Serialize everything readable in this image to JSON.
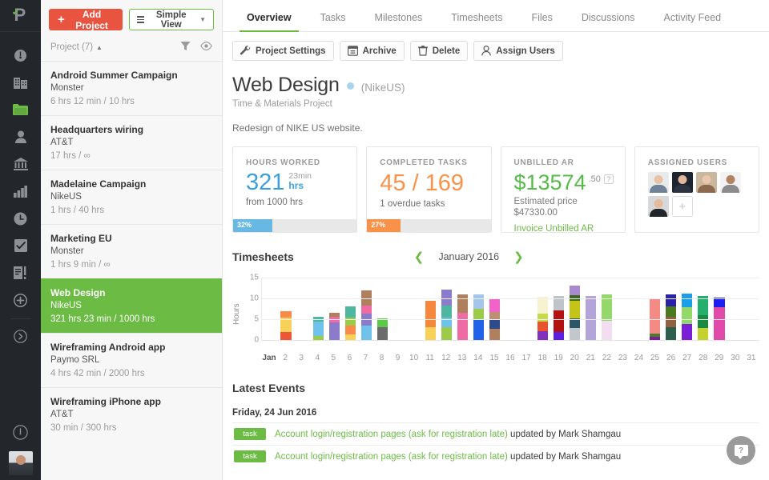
{
  "rail": {
    "logo_name": "paymo-logo",
    "items": [
      {
        "name": "dashboard-icon"
      },
      {
        "name": "clients-icon"
      },
      {
        "name": "projects-icon"
      },
      {
        "name": "users-icon"
      },
      {
        "name": "bank-icon"
      },
      {
        "name": "reports-icon"
      },
      {
        "name": "timesheets-icon"
      },
      {
        "name": "tasks-icon"
      },
      {
        "name": "invoices-icon"
      },
      {
        "name": "add-icon"
      },
      {
        "name": "expand-icon"
      }
    ],
    "timer_icon": "timer-icon",
    "avatar_name": "user-avatar"
  },
  "sidebar": {
    "add_project_label": "Add Project",
    "view_label": "Simple View",
    "list_title": "Project (7)",
    "filter_icon": "filter-icon",
    "eye_icon": "eye-icon",
    "projects": [
      {
        "name": "Android Summer Campaign",
        "client": "Monster",
        "hours": "6 hrs 12 min / 10 hrs",
        "selected": false
      },
      {
        "name": "Headquarters wiring",
        "client": "AT&T",
        "hours": "17 hrs / ∞",
        "selected": false
      },
      {
        "name": "Madelaine Campaign",
        "client": "NikeUS",
        "hours": "1 hrs / 40 hrs",
        "selected": false
      },
      {
        "name": "Marketing EU",
        "client": "Monster",
        "hours": "1 hrs 9 min / ∞",
        "selected": false
      },
      {
        "name": "Web Design",
        "client": "NikeUS",
        "hours": "321 hrs 23 min / 1000 hrs",
        "selected": true
      },
      {
        "name": "Wireframing Android app",
        "client": "Paymo SRL",
        "hours": "4 hrs 42 min / 2000 hrs",
        "selected": false
      },
      {
        "name": "Wireframing iPhone app",
        "client": "AT&T",
        "hours": "30 min / 300 hrs",
        "selected": false
      }
    ]
  },
  "tabs": [
    {
      "label": "Overview",
      "active": true
    },
    {
      "label": "Tasks",
      "active": false
    },
    {
      "label": "Milestones",
      "active": false
    },
    {
      "label": "Timesheets",
      "active": false
    },
    {
      "label": "Files",
      "active": false
    },
    {
      "label": "Discussions",
      "active": false
    },
    {
      "label": "Activity Feed",
      "active": false
    }
  ],
  "toolbar": [
    {
      "label": "Project Settings",
      "icon": "wrench-icon"
    },
    {
      "label": "Archive",
      "icon": "archive-icon"
    },
    {
      "label": "Delete",
      "icon": "trash-icon"
    },
    {
      "label": "Assign Users",
      "icon": "person-icon"
    }
  ],
  "project": {
    "title": "Web Design",
    "status_dot_color": "#a8d4ea",
    "client": "(NikeUS)",
    "type": "Time & Materials Project",
    "description": "Redesign of NIKE US website."
  },
  "cards": {
    "hours": {
      "label": "HOURS WORKED",
      "value": "321",
      "minutes": "23min",
      "unit": "hrs",
      "sub": "from 1000 hrs",
      "progress_pct": "32%",
      "progress_value": 32,
      "color": "#67b8e3"
    },
    "tasks": {
      "label": "COMPLETED TASKS",
      "value": "45 / 169",
      "sub": "1 overdue tasks",
      "progress_pct": "27%",
      "progress_value": 27,
      "color": "#f79248"
    },
    "unbilled": {
      "label": "UNBILLED AR",
      "value": "$13574",
      "cents": ".50",
      "help": "?",
      "sub_line1": "Estimated price",
      "sub_line2": "$47330.00",
      "link": "Invoice Unbilled AR"
    },
    "users": {
      "label": "ASSIGNED USERS",
      "add_label": "+",
      "avatars": [
        {
          "name": "avatar-1",
          "bg": "#e9eaec",
          "skin": "#e8c2a4",
          "shirt": "#6f8398"
        },
        {
          "name": "avatar-2",
          "bg": "#1d2530",
          "skin": "#e2b79b",
          "shirt": "#2b3440"
        },
        {
          "name": "avatar-3",
          "bg": "#cbb79e",
          "skin": "#e8c7ab",
          "shirt": "#8d6a4e"
        },
        {
          "name": "avatar-4",
          "bg": "#f2f2f2",
          "skin": "#b0825f",
          "shirt": "#8c8c8c"
        },
        {
          "name": "avatar-5",
          "bg": "#d6d8da",
          "skin": "#e5bb99",
          "shirt": "#23272c"
        }
      ]
    }
  },
  "timesheets": {
    "title": "Timesheets",
    "month": "January 2016",
    "prev_icon": "chevron-left-icon",
    "next_icon": "chevron-right-icon"
  },
  "chart_data": {
    "type": "bar",
    "stacked": true,
    "title": "Timesheets",
    "xlabel": "",
    "ylabel": "Hours",
    "ylim": [
      0,
      15
    ],
    "yticks": [
      0,
      5,
      10,
      15
    ],
    "grid": true,
    "categories": [
      "Jan",
      "2",
      "3",
      "4",
      "5",
      "6",
      "7",
      "8",
      "9",
      "10",
      "11",
      "12",
      "13",
      "14",
      "15",
      "16",
      "17",
      "18",
      "19",
      "20",
      "21",
      "22",
      "23",
      "24",
      "25",
      "26",
      "27",
      "28",
      "29",
      "30",
      "31"
    ],
    "totals": [
      0,
      7,
      0,
      5.5,
      6.5,
      8,
      12,
      5.2,
      0,
      0,
      9.4,
      12.1,
      10.9,
      10.9,
      10.1,
      0,
      0,
      10.4,
      10.5,
      13,
      10.5,
      10.9,
      0,
      0,
      10.1,
      10.9,
      11.1,
      10.6,
      10.1,
      0,
      0
    ],
    "bars": [
      {
        "day": "Jan",
        "segments": []
      },
      {
        "day": "2",
        "segments": [
          {
            "v": 2,
            "c": "#ed5739"
          },
          {
            "v": 3.4,
            "c": "#f8d258"
          },
          {
            "v": 1.6,
            "c": "#f88b49"
          }
        ]
      },
      {
        "day": "3",
        "segments": []
      },
      {
        "day": "4",
        "segments": [
          {
            "v": 0.9,
            "c": "#9ccb4a"
          },
          {
            "v": 3.5,
            "c": "#6fc3ea"
          },
          {
            "v": 1.1,
            "c": "#4fb6a0"
          }
        ]
      },
      {
        "day": "5",
        "segments": [
          {
            "v": 4.2,
            "c": "#8a7ccb"
          },
          {
            "v": 1.4,
            "c": "#ef6ba4"
          },
          {
            "v": 0.9,
            "c": "#b07f5e"
          }
        ]
      },
      {
        "day": "6",
        "segments": [
          {
            "v": 1.3,
            "c": "#f8d258"
          },
          {
            "v": 2.1,
            "c": "#f88b49"
          },
          {
            "v": 1.9,
            "c": "#9ccb4a"
          },
          {
            "v": 2.7,
            "c": "#4fb6a0"
          }
        ]
      },
      {
        "day": "7",
        "segments": [
          {
            "v": 3.4,
            "c": "#6fc3ea"
          },
          {
            "v": 3,
            "c": "#8a7ccb"
          },
          {
            "v": 1.8,
            "c": "#ef6ba4"
          },
          {
            "v": 3.8,
            "c": "#b07f5e"
          }
        ]
      },
      {
        "day": "8",
        "segments": [
          {
            "v": 3,
            "c": "#6b6b6b"
          },
          {
            "v": 2.2,
            "c": "#5ec948"
          }
        ]
      },
      {
        "day": "9",
        "segments": []
      },
      {
        "day": "10",
        "segments": []
      },
      {
        "day": "11",
        "segments": [
          {
            "v": 3.1,
            "c": "#f8d258"
          },
          {
            "v": 6.3,
            "c": "#f5883c"
          }
        ]
      },
      {
        "day": "12",
        "segments": [
          {
            "v": 3.1,
            "c": "#9ccb4a"
          },
          {
            "v": 2.3,
            "c": "#6fc3ea"
          },
          {
            "v": 2.9,
            "c": "#4fb6a0"
          },
          {
            "v": 3.8,
            "c": "#8a7ccb"
          }
        ]
      },
      {
        "day": "13",
        "segments": [
          {
            "v": 6.6,
            "c": "#ef6ba4"
          },
          {
            "v": 4.3,
            "c": "#b07f5e"
          }
        ]
      },
      {
        "day": "14",
        "segments": [
          {
            "v": 4.9,
            "c": "#1f63e8"
          },
          {
            "v": 2.6,
            "c": "#9ccb4a"
          },
          {
            "v": 3.4,
            "c": "#a3c6ea"
          }
        ]
      },
      {
        "day": "15",
        "segments": [
          {
            "v": 2.7,
            "c": "#b07f5e"
          },
          {
            "v": 2.3,
            "c": "#2c4b8c"
          },
          {
            "v": 1.7,
            "c": "#bd8f72"
          },
          {
            "v": 3.4,
            "c": "#f163c9"
          }
        ]
      },
      {
        "day": "16",
        "segments": []
      },
      {
        "day": "17",
        "segments": []
      },
      {
        "day": "18",
        "segments": [
          {
            "v": 2.1,
            "c": "#8231bd"
          },
          {
            "v": 2.4,
            "c": "#e8542e"
          },
          {
            "v": 1.9,
            "c": "#c5d94a"
          },
          {
            "v": 4,
            "c": "#f7f2cf"
          }
        ]
      },
      {
        "day": "19",
        "segments": [
          {
            "v": 2,
            "c": "#5b20e0"
          },
          {
            "v": 5.2,
            "c": "#b21212"
          },
          {
            "v": 3.3,
            "c": "#bfc4c8"
          }
        ]
      },
      {
        "day": "20",
        "segments": [
          {
            "v": 2.9,
            "c": "#c2c7cb"
          },
          {
            "v": 2.3,
            "c": "#2d5666"
          },
          {
            "v": 4.3,
            "c": "#c3c318"
          },
          {
            "v": 1.2,
            "c": "#3d6a1a"
          },
          {
            "v": 2.3,
            "c": "#a78ad0"
          }
        ]
      },
      {
        "day": "21",
        "segments": [
          {
            "v": 10.5,
            "c": "#b3a4da"
          }
        ]
      },
      {
        "day": "22",
        "segments": [
          {
            "v": 4.6,
            "c": "#f3ddf0"
          },
          {
            "v": 6.3,
            "c": "#93d96a"
          }
        ]
      },
      {
        "day": "23",
        "segments": []
      },
      {
        "day": "24",
        "segments": []
      },
      {
        "day": "25",
        "segments": [
          {
            "v": 0.8,
            "c": "#7a1e93"
          },
          {
            "v": 0.8,
            "c": "#4a7a2b"
          },
          {
            "v": 8.5,
            "c": "#f58a85"
          }
        ]
      },
      {
        "day": "26",
        "segments": [
          {
            "v": 3.1,
            "c": "#2c5f4c"
          },
          {
            "v": 2.4,
            "c": "#8f6240"
          },
          {
            "v": 2.5,
            "c": "#4a7a1e"
          },
          {
            "v": 2.9,
            "c": "#2a23a8"
          }
        ]
      },
      {
        "day": "27",
        "segments": [
          {
            "v": 3.9,
            "c": "#7b1fd6"
          },
          {
            "v": 4,
            "c": "#93d96a"
          },
          {
            "v": 3.2,
            "c": "#1b9ee8"
          }
        ]
      },
      {
        "day": "28",
        "segments": [
          {
            "v": 2.9,
            "c": "#c3d22c"
          },
          {
            "v": 3.1,
            "c": "#1a8a43"
          },
          {
            "v": 4.6,
            "c": "#24b06c"
          }
        ]
      },
      {
        "day": "29",
        "segments": [
          {
            "v": 7.9,
            "c": "#e14aa8"
          },
          {
            "v": 2.2,
            "c": "#1b1ff2"
          }
        ]
      },
      {
        "day": "30",
        "segments": []
      },
      {
        "day": "31",
        "segments": []
      }
    ]
  },
  "events": {
    "title": "Latest Events",
    "date": "Friday, 24 Jun 2016",
    "rows": [
      {
        "tag": "task",
        "link": "Account login/registration pages (ask for registration late)",
        "rest": "updated by Mark Shamgau"
      },
      {
        "tag": "task",
        "link": "Account login/registration pages (ask for registration late)",
        "rest": "updated by Mark Shamgau"
      }
    ]
  },
  "help": {
    "label": "?",
    "icon": "help-bubble-icon"
  }
}
